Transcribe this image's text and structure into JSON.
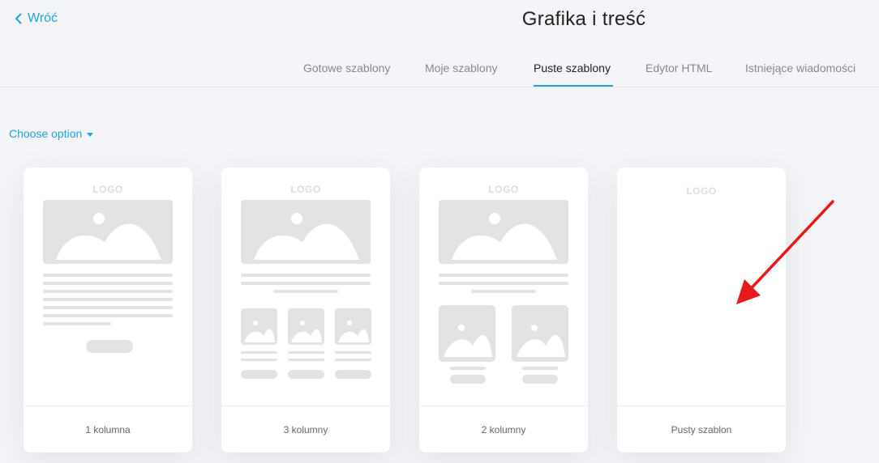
{
  "header": {
    "back_label": "Wróć",
    "title": "Grafika i treść"
  },
  "tabs": [
    {
      "label": "Gotowe szablony",
      "active": false
    },
    {
      "label": "Moje szablony",
      "active": false
    },
    {
      "label": "Puste szablony",
      "active": true
    },
    {
      "label": "Edytor HTML",
      "active": false
    },
    {
      "label": "Istniejące wiadomości",
      "active": false
    }
  ],
  "filter": {
    "choose_label": "Choose option"
  },
  "templates": [
    {
      "logo": "LOGO",
      "label": "1 kolumna"
    },
    {
      "logo": "LOGO",
      "label": "3 kolumny"
    },
    {
      "logo": "LOGO",
      "label": "2 kolumny"
    },
    {
      "logo": "LOGO",
      "label": "Pusty szablon"
    }
  ],
  "colors": {
    "accent": "#1fa3dc",
    "background": "#f4f5f8",
    "annotation_arrow": "#e8191b",
    "placeholder": "#e2e2e2"
  }
}
